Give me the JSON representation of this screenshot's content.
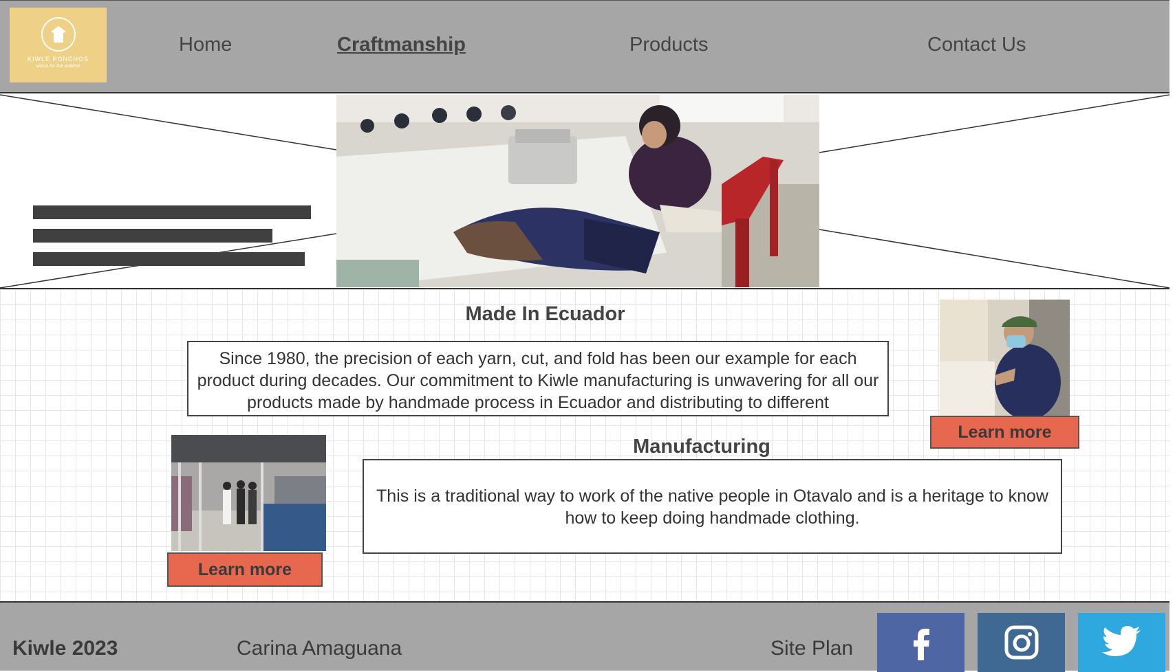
{
  "header": {
    "logo": {
      "name": "KIWLE PONCHOS",
      "tagline": "warm for the coldest",
      "bg_color": "#efd087"
    },
    "nav": [
      {
        "label": "Home",
        "active": false
      },
      {
        "label": "Craftmanship",
        "active": true
      },
      {
        "label": "Products",
        "active": false
      },
      {
        "label": "Contact Us",
        "active": false
      }
    ]
  },
  "sections": {
    "made_in_ecuador": {
      "title": "Made In Ecuador",
      "body": "Since 1980, the precision of each yarn, cut, and fold has been our example for each product during decades. Our commitment to Kiwle manufacturing is unwavering for all our products made by handmade process in Ecuador and distributing to different",
      "button": "Learn more"
    },
    "manufacturing": {
      "title": "Manufacturing",
      "body": "This is a traditional way to work of the native people in Otavalo and is a heritage to know how to keep doing handmade clothing.",
      "button": "Learn more"
    }
  },
  "footer": {
    "brand": "Kiwle 2023",
    "author": "Carina Amaguana",
    "site_plan": "Site Plan",
    "social": [
      {
        "icon": "facebook-icon",
        "color": "#4e67a4"
      },
      {
        "icon": "instagram-icon",
        "color": "#3f6892"
      },
      {
        "icon": "twitter-icon",
        "color": "#2fa8e0"
      }
    ]
  },
  "colors": {
    "button": "#e8674f",
    "header_bg": "#a6a6a6"
  }
}
